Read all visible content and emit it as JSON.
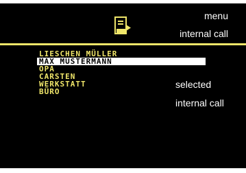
{
  "annotations": {
    "menu": "menu",
    "internal_call_top": "internal call",
    "selected": "selected",
    "internal_call_bottom": "internal call"
  },
  "header": {
    "icon": "phonebook-icon"
  },
  "colors": {
    "accent": "#f0e66a",
    "background": "#000000",
    "selection": "#ffffff"
  },
  "contacts": [
    {
      "label": "LIESCHEN MÜLLER",
      "selected": false
    },
    {
      "label": "MAX MUSTERMANN",
      "selected": true
    },
    {
      "label": "OPA",
      "selected": false
    },
    {
      "label": "CARSTEN",
      "selected": false
    },
    {
      "label": "WERKSTATT",
      "selected": false
    },
    {
      "label": "BÜRO",
      "selected": false
    }
  ]
}
